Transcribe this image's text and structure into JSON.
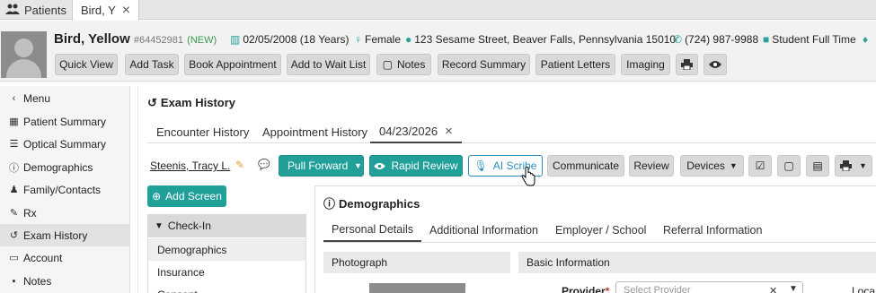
{
  "top_tabs": {
    "patients": "Patients",
    "patient": "Bird, Y"
  },
  "patient": {
    "name": "Bird, Yellow",
    "id": "#64452981",
    "status": "(NEW)",
    "dob": "02/05/2008 (18 Years)",
    "sex": "Female",
    "address": "123 Sesame Street, Beaver Falls, Pennsylvania 15010",
    "phone": "(724) 987-9988",
    "employment": "Student Full Time"
  },
  "header_buttons": [
    "Quick View",
    "Add Task",
    "Book Appointment",
    "Add to Wait List",
    "Notes",
    "Record Summary",
    "Patient Letters",
    "Imaging"
  ],
  "sidebar": {
    "items": [
      {
        "label": "Menu",
        "icon": "chevron-left-icon"
      },
      {
        "label": "Patient Summary",
        "icon": "grid-icon"
      },
      {
        "label": "Optical Summary",
        "icon": "list-icon"
      },
      {
        "label": "Demographics",
        "icon": "info-icon"
      },
      {
        "label": "Family/Contacts",
        "icon": "users-icon"
      },
      {
        "label": "Rx",
        "icon": "prescription-icon"
      },
      {
        "label": "Exam History",
        "icon": "history-icon"
      },
      {
        "label": "Account",
        "icon": "money-icon"
      },
      {
        "label": "Notes",
        "icon": "note-icon"
      }
    ],
    "active": "Exam History"
  },
  "main": {
    "title": "Exam History",
    "tabs": [
      "Encounter History",
      "Appointment History",
      "04/23/2026"
    ],
    "active_tab": "04/23/2026",
    "provider": "Steenis, Tracy L.",
    "actions": {
      "pull_forward": "Pull Forward",
      "rapid_review": "Rapid Review",
      "ai_scribe": "AI Scribe",
      "communicate": "Communicate",
      "review": "Review",
      "devices": "Devices"
    },
    "add_screen": "Add Screen",
    "checkin": {
      "header": "Check-In",
      "items": [
        "Demographics",
        "Insurance",
        "Consent"
      ]
    }
  },
  "demographics": {
    "title": "Demographics",
    "tabs": [
      "Personal Details",
      "Additional Information",
      "Employer / School",
      "Referral Information"
    ],
    "active_tab": "Personal Details",
    "sections": {
      "photograph": "Photograph",
      "basic": "Basic Information"
    },
    "provider_label": "Provider",
    "provider_placeholder": "Select Provider",
    "location_label": "Loca"
  },
  "colors": {
    "teal": "#21a09a",
    "link_blue": "#2a8fbd"
  }
}
